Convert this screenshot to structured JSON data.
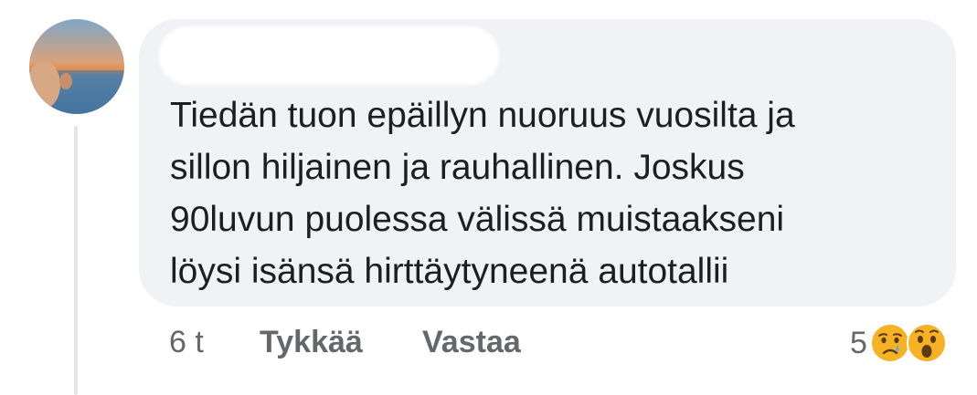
{
  "comment": {
    "text_lines": [
      "Tiedän tuon epäillyn nuoruus vuosilta ja",
      "sillon hiljainen ja rauhallinen. Joskus",
      "90luvun puolessa välissä muistaakseni",
      "löysi isänsä hirttäytyneenä autotallii"
    ],
    "author_name_redacted": true
  },
  "actions": {
    "time": "6 t",
    "like_label": "Tykkää",
    "reply_label": "Vastaa"
  },
  "reactions": {
    "count": "5",
    "icons": [
      "crying-face-icon",
      "wow-face-icon"
    ]
  },
  "colors": {
    "bubble": "#f0f2f5",
    "text": "#1c1e21",
    "secondary_text": "#65676b",
    "emoji_yellow": "#f7b125"
  }
}
